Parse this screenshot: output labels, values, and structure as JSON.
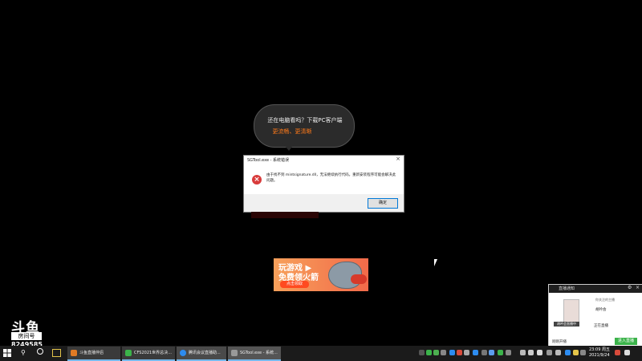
{
  "bubble": {
    "line1": "还在电脑看吗？下载PC客户端",
    "line2": "更流畅、更清晰"
  },
  "dialog": {
    "title": "SGTool.exe - 系统错误",
    "close": "×",
    "message": "由于找不到 mintsignature.dll，无法继续执行代码。重新安装程序可能会解决此问题。",
    "ok_label": "确定"
  },
  "ad": {
    "line1": "玩游戏 ▶",
    "line2": "免费领火箭",
    "button": "点击领取"
  },
  "watermark": {
    "logo": "斗鱼",
    "label": "房间号",
    "number": "8249585"
  },
  "notification": {
    "title": "直播通知",
    "gear": "⚙",
    "close": "×",
    "subtitle": "你关注的主播",
    "name": "胡吟会",
    "overlay": "胡吟会直播中",
    "status": "正在直播",
    "time": "刚刚开播",
    "enter_label": "进入直播"
  },
  "taskbar": {
    "tasks": [
      {
        "label": "斗鱼直播伴侣",
        "color": "#e07a24"
      },
      {
        "label": "CFS2021世界总决...",
        "color": "#3bb34a"
      },
      {
        "label": "腾讯会议直播助...",
        "color": "#2d8cf0"
      },
      {
        "label": "SGTool.exe - 系统...",
        "color": "#999999"
      }
    ],
    "clock_time": "23:09 周五",
    "clock_date": "2021/9/24"
  }
}
